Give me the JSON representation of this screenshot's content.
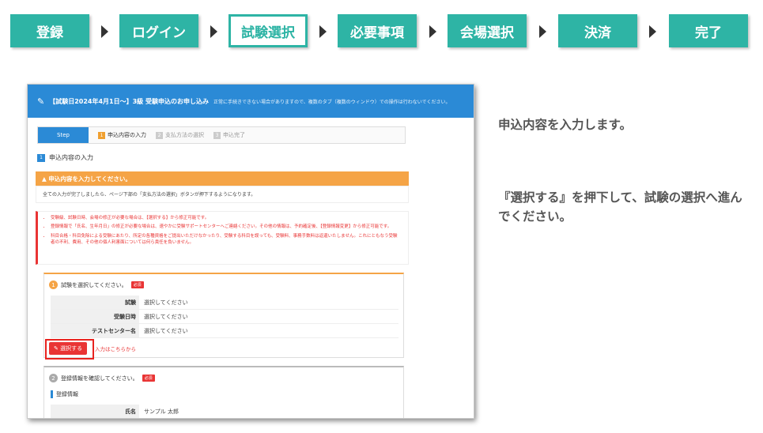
{
  "steps": [
    {
      "label": "登録",
      "active": false
    },
    {
      "label": "ログイン",
      "active": false
    },
    {
      "label": "試験選択",
      "active": true
    },
    {
      "label": "必要事項",
      "active": false
    },
    {
      "label": "会場選択",
      "active": false
    },
    {
      "label": "決済",
      "active": false
    },
    {
      "label": "完了",
      "active": false
    }
  ],
  "screenshot": {
    "header_title": "【試験日2024年4月1日〜】3級 受験申込のお申し込み",
    "header_note": "正常に手続きできない場合がありますので、複数のタブ（複数のウィンドウ）での操作は行わないでください。",
    "progress": {
      "step_label": "Step",
      "items": [
        {
          "num": "1",
          "label": "申込内容の入力"
        },
        {
          "num": "2",
          "label": "支払方法の選択"
        },
        {
          "num": "3",
          "label": "申込完了"
        }
      ]
    },
    "section_num": "1",
    "section_title": "申込内容の入力",
    "warning_title": "▲ 申込内容を入力してください。",
    "warning_body": "全ての入力が完了しましたら、ページ下部の「支払方法の選択」ボタンが押下するようになります。",
    "notices": [
      "受験級、試験日時、会場の修正が必要な場合は、【選択する】から修正可能です。",
      "登録情報で「氏名、生年月日」の修正が必要な場合は、速やかに受験サポートセンターへご連絡ください。その他の情報は、予約確定後、【登録情報変更】から修正可能です。",
      "科目合格・科目免除による受験にあたり、所定の各種資格をご提出いただけなかったり、受験する科目を誤っても、受験料、事務手数料は返還いたしません。これにともなう受験者の不利、費用、その他の個人利害面については何ら責任を負いません。"
    ],
    "card1": {
      "num": "1",
      "title": "試験を選択してください。",
      "required": "必須",
      "rows": [
        {
          "label": "試験",
          "value": "選択してください"
        },
        {
          "label": "受験日時",
          "value": "選択してください"
        },
        {
          "label": "テストセンター名",
          "value": "選択してください"
        }
      ],
      "select_button": "✎ 選択する",
      "link_text": "入力はこちらから"
    },
    "card2": {
      "num": "2",
      "title": "登録情報を確認してください。",
      "required": "必須",
      "info_title": "登録情報",
      "rows": [
        {
          "label": "氏名",
          "value": "サンプル 太郎"
        }
      ]
    }
  },
  "instructions": {
    "line1": "申込内容を入力します。",
    "line2": "『選択する』を押下して、試験の選択へ進んでください。"
  },
  "colors": {
    "step_green": "#2eb4a5",
    "header_blue": "#2b8ad6",
    "warning_orange": "#f5a446",
    "alert_red": "#e93434"
  }
}
